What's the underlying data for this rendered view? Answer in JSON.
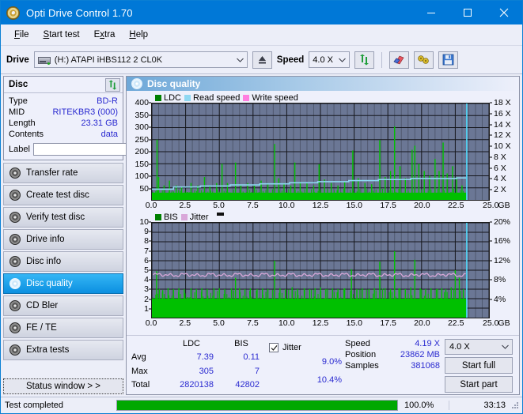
{
  "window": {
    "title": "Opti Drive Control 1.70",
    "icon": "disc-icon",
    "minimize": "minimize-icon",
    "maximize": "maximize-icon",
    "close": "close-icon"
  },
  "menu": {
    "items": [
      {
        "label": "File",
        "accel": "F"
      },
      {
        "label": "Start test",
        "accel": "S"
      },
      {
        "label": "Extra",
        "accel": "x"
      },
      {
        "label": "Help",
        "accel": "H"
      }
    ]
  },
  "toolbar": {
    "drive_label": "Drive",
    "drive_value": "(H:)  ATAPI iHBS112  2 CL0K",
    "drive_icon": "drive-icon",
    "eject_icon": "eject-icon",
    "speed_label": "Speed",
    "speed_value": "4.0 X",
    "refresh_icon": "refresh-icon",
    "eraser_icon": "eraser-icon",
    "bitsetting_icon": "bitsetting-icon",
    "save_icon": "save-icon"
  },
  "sidebar": {
    "disc_panel": {
      "title": "Disc",
      "refresh_icon": "refresh-icon",
      "rows": [
        {
          "key": "Type",
          "value": "BD-R"
        },
        {
          "key": "MID",
          "value": "RITEKBR3 (000)"
        },
        {
          "key": "Length",
          "value": "23.31 GB"
        },
        {
          "key": "Contents",
          "value": "data"
        }
      ],
      "label_key": "Label",
      "label_value": "",
      "label_placeholder": "",
      "label_button_icon": "disc-icon"
    },
    "nav": [
      {
        "label": "Transfer rate",
        "icon": "disc-icon",
        "active": false
      },
      {
        "label": "Create test disc",
        "icon": "disc-icon",
        "active": false
      },
      {
        "label": "Verify test disc",
        "icon": "disc-icon",
        "active": false
      },
      {
        "label": "Drive info",
        "icon": "disc-icon",
        "active": false
      },
      {
        "label": "Disc info",
        "icon": "disc-icon",
        "active": false
      },
      {
        "label": "Disc quality",
        "icon": "disc-icon",
        "active": true
      },
      {
        "label": "CD Bler",
        "icon": "disc-icon",
        "active": false
      },
      {
        "label": "FE / TE",
        "icon": "disc-icon",
        "active": false
      },
      {
        "label": "Extra tests",
        "icon": "disc-icon",
        "active": false
      }
    ],
    "status_window_button": "Status window > >"
  },
  "content": {
    "header": "Disc quality",
    "header_icon": "disc-icon"
  },
  "chart_data": [
    {
      "type": "line",
      "id": "ldc-chart",
      "title": "",
      "legend": [
        {
          "label": "LDC",
          "color": "#008000"
        },
        {
          "label": "Read speed",
          "color": "#8fd8f2"
        },
        {
          "label": "Write speed",
          "color": "#ff7fe0"
        }
      ],
      "legend_position": "top-left",
      "xlabel": "GB",
      "x_ticks": [
        "0.0",
        "2.5",
        "5.0",
        "7.5",
        "10.0",
        "12.5",
        "15.0",
        "17.5",
        "20.0",
        "22.5",
        "25.0"
      ],
      "xlim": [
        0,
        25
      ],
      "ylabel_left": "LDC",
      "y_ticks_left": [
        "400",
        "350",
        "300",
        "250",
        "200",
        "150",
        "100",
        "50"
      ],
      "ylim_left": [
        0,
        400
      ],
      "ylabel_right": "Speed",
      "y_ticks_right": [
        "18 X",
        "16 X",
        "14 X",
        "12 X",
        "10 X",
        "8 X",
        "6 X",
        "4 X",
        "2 X"
      ],
      "ylim_right": [
        0,
        18
      ],
      "grid": true,
      "series": [
        {
          "name": "LDC",
          "color": "#00c000",
          "kind": "spikes",
          "baseline": 30,
          "peaks": [
            [
              0.38,
              250
            ],
            [
              0.5,
              95
            ],
            [
              0.9,
              60
            ],
            [
              1.3,
              80
            ],
            [
              1.8,
              60
            ],
            [
              2.2,
              55
            ],
            [
              2.9,
              70
            ],
            [
              3.4,
              60
            ],
            [
              3.9,
              95
            ],
            [
              4.3,
              60
            ],
            [
              4.8,
              70
            ],
            [
              5.2,
              150
            ],
            [
              5.6,
              70
            ],
            [
              6.2,
              155
            ],
            [
              6.6,
              60
            ],
            [
              7.1,
              70
            ],
            [
              7.6,
              62
            ],
            [
              8.1,
              80
            ],
            [
              8.6,
              70
            ],
            [
              9.1,
              232
            ],
            [
              9.4,
              90
            ],
            [
              9.8,
              70
            ],
            [
              10.3,
              60
            ],
            [
              10.6,
              155
            ],
            [
              11.0,
              75
            ],
            [
              11.5,
              70
            ],
            [
              12.0,
              60
            ],
            [
              12.4,
              148
            ],
            [
              12.8,
              85
            ],
            [
              13.3,
              70
            ],
            [
              13.8,
              60
            ],
            [
              14.3,
              75
            ],
            [
              14.9,
              205
            ],
            [
              15.3,
              90
            ],
            [
              15.8,
              70
            ],
            [
              16.3,
              65
            ],
            [
              16.9,
              248
            ],
            [
              17.3,
              95
            ],
            [
              17.7,
              120
            ],
            [
              18.0,
              305
            ],
            [
              18.4,
              140
            ],
            [
              18.8,
              90
            ],
            [
              19.3,
              208
            ],
            [
              19.5,
              225
            ],
            [
              19.8,
              150
            ],
            [
              20.2,
              120
            ],
            [
              20.6,
              100
            ],
            [
              21.0,
              170
            ],
            [
              21.3,
              120
            ],
            [
              21.6,
              238
            ],
            [
              21.9,
              110
            ],
            [
              22.3,
              140
            ],
            [
              22.6,
              95
            ],
            [
              23.0,
              60
            ]
          ]
        },
        {
          "name": "Read speed",
          "color": "#8fd8f2",
          "kind": "step-line",
          "points": [
            [
              0.0,
              2.0
            ],
            [
              1.0,
              2.0
            ],
            [
              1.6,
              2.4
            ],
            [
              3.0,
              2.4
            ],
            [
              3.6,
              2.6
            ],
            [
              5.2,
              2.6
            ],
            [
              5.8,
              2.8
            ],
            [
              7.5,
              2.8
            ],
            [
              8.0,
              3.0
            ],
            [
              9.6,
              3.0
            ],
            [
              10.2,
              3.2
            ],
            [
              11.8,
              3.2
            ],
            [
              12.3,
              3.4
            ],
            [
              14.0,
              3.4
            ],
            [
              14.6,
              3.6
            ],
            [
              16.2,
              3.6
            ],
            [
              16.8,
              3.8
            ],
            [
              18.6,
              3.8
            ],
            [
              19.2,
              4.0
            ],
            [
              22.6,
              4.1
            ],
            [
              23.3,
              4.2
            ]
          ]
        }
      ],
      "end_marker": {
        "x": 23.35,
        "color": "#4fd6f7",
        "label": "scan-end"
      }
    },
    {
      "type": "line",
      "id": "bis-chart",
      "title": "",
      "legend": [
        {
          "label": "BIS",
          "color": "#008000"
        },
        {
          "label": "Jitter",
          "color": "#d9a8d9"
        }
      ],
      "legend_position": "top-left",
      "xlabel": "GB",
      "x_ticks": [
        "0.0",
        "2.5",
        "5.0",
        "7.5",
        "10.0",
        "12.5",
        "15.0",
        "17.5",
        "20.0",
        "22.5",
        "25.0"
      ],
      "xlim": [
        0,
        25
      ],
      "ylabel_left": "BIS",
      "y_ticks_left": [
        "10",
        "9",
        "8",
        "7",
        "6",
        "5",
        "4",
        "3",
        "2",
        "1"
      ],
      "ylim_left": [
        0,
        10
      ],
      "ylabel_right": "Jitter",
      "y_ticks_right": [
        "20%",
        "16%",
        "12%",
        "8%",
        "4%"
      ],
      "ylim_right": [
        0,
        20
      ],
      "grid": true,
      "series": [
        {
          "name": "BIS",
          "color": "#00c000",
          "kind": "spikes",
          "baseline": 2.0,
          "peaks": [
            [
              0.35,
              4.9
            ],
            [
              0.55,
              3.0
            ],
            [
              0.8,
              2.9
            ],
            [
              1.2,
              3.1
            ],
            [
              1.6,
              3.0
            ],
            [
              2.0,
              3.1
            ],
            [
              2.4,
              3.0
            ],
            [
              2.9,
              3.1
            ],
            [
              3.3,
              3.0
            ],
            [
              3.7,
              3.1
            ],
            [
              4.1,
              3.0
            ],
            [
              4.6,
              3.1
            ],
            [
              5.0,
              3.1
            ],
            [
              5.4,
              3.0
            ],
            [
              5.9,
              3.1
            ],
            [
              6.2,
              4.2
            ],
            [
              6.5,
              3.1
            ],
            [
              6.9,
              3.0
            ],
            [
              7.3,
              3.1
            ],
            [
              7.8,
              3.0
            ],
            [
              8.2,
              3.1
            ],
            [
              8.6,
              3.0
            ],
            [
              9.1,
              6.0
            ],
            [
              9.5,
              3.1
            ],
            [
              9.9,
              3.0
            ],
            [
              10.4,
              3.2
            ],
            [
              10.8,
              3.0
            ],
            [
              11.3,
              3.1
            ],
            [
              11.7,
              3.0
            ],
            [
              12.1,
              3.1
            ],
            [
              12.5,
              3.2
            ],
            [
              12.9,
              3.0
            ],
            [
              13.4,
              3.1
            ],
            [
              13.8,
              3.0
            ],
            [
              14.3,
              3.1
            ],
            [
              14.8,
              5.1
            ],
            [
              15.2,
              3.0
            ],
            [
              15.6,
              3.1
            ],
            [
              16.1,
              3.0
            ],
            [
              16.5,
              3.1
            ],
            [
              16.9,
              5.9
            ],
            [
              17.3,
              3.1
            ],
            [
              17.7,
              3.0
            ],
            [
              18.0,
              7.0
            ],
            [
              18.4,
              3.1
            ],
            [
              18.8,
              3.0
            ],
            [
              19.2,
              3.2
            ],
            [
              19.5,
              6.1
            ],
            [
              19.9,
              3.1
            ],
            [
              20.3,
              3.0
            ],
            [
              20.7,
              3.1
            ],
            [
              21.1,
              3.0
            ],
            [
              21.5,
              3.1
            ],
            [
              21.8,
              3.0
            ],
            [
              22.2,
              3.2
            ],
            [
              22.5,
              5.0
            ],
            [
              22.8,
              4.2
            ],
            [
              23.1,
              3.0
            ]
          ]
        },
        {
          "name": "Jitter",
          "color": "#d9a8d9",
          "kind": "noisy-line",
          "mean_pct": 9.0,
          "amplitude_pct": 0.5,
          "start_x": 0.1,
          "end_x": 23.3
        }
      ],
      "end_marker": {
        "x": 23.35,
        "color": "#4fd6f7",
        "label": "scan-end"
      }
    }
  ],
  "stats": {
    "col_headers": [
      "LDC",
      "BIS"
    ],
    "rows": [
      {
        "label": "Avg",
        "ldc": "7.39",
        "bis": "0.11",
        "jitter": "9.0%"
      },
      {
        "label": "Max",
        "ldc": "305",
        "bis": "7",
        "jitter": "10.4%"
      },
      {
        "label": "Total",
        "ldc": "2820138",
        "bis": "42802",
        "jitter": ""
      }
    ],
    "jitter_label": "Jitter",
    "jitter_checked": true,
    "speed_label": "Speed",
    "speed_value": "4.19 X",
    "position_label": "Position",
    "position_value": "23862 MB",
    "samples_label": "Samples",
    "samples_value": "381068",
    "speed_select": "4.0 X",
    "start_full_button": "Start full",
    "start_part_button": "Start part"
  },
  "statusbar": {
    "message": "Test completed",
    "progress_percent": 100,
    "progress_text": "100.0%",
    "elapsed": "33:13",
    "progress_color": "#00a800"
  }
}
